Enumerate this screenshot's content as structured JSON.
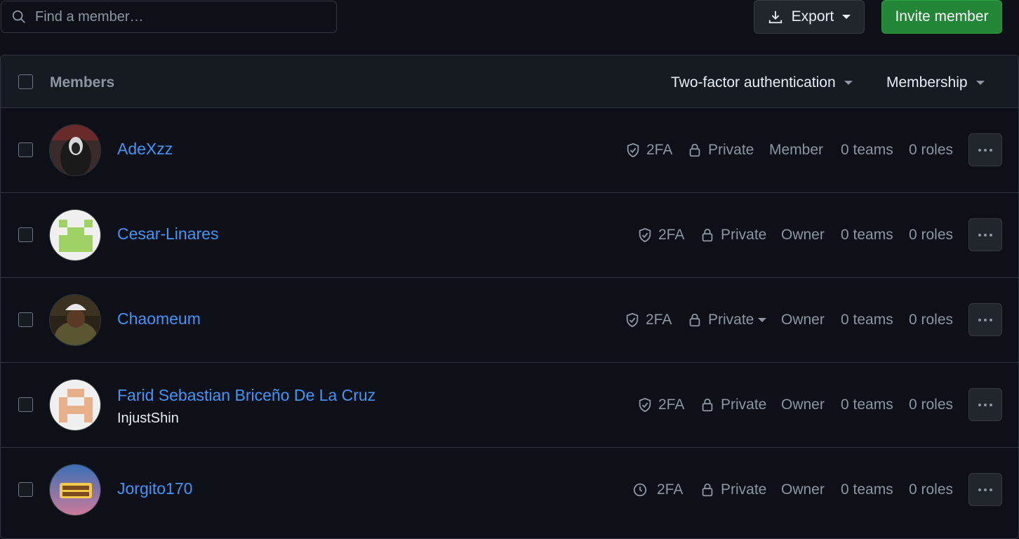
{
  "search": {
    "placeholder": "Find a member…"
  },
  "actions": {
    "export_label": "Export",
    "invite_label": "Invite member"
  },
  "table": {
    "header": {
      "title": "Members",
      "filter_2fa": "Two-factor authentication",
      "filter_membership": "Membership"
    },
    "rows": [
      {
        "name": "AdeXzz",
        "login": "",
        "twofa": "2FA",
        "twofa_icon": "shield-check-icon",
        "visibility": "Private",
        "visibility_dropdown": false,
        "role": "Member",
        "teams": "0 teams",
        "roles": "0 roles"
      },
      {
        "name": "Cesar-Linares",
        "login": "",
        "twofa": "2FA",
        "twofa_icon": "shield-check-icon",
        "visibility": "Private",
        "visibility_dropdown": false,
        "role": "Owner",
        "teams": "0 teams",
        "roles": "0 roles"
      },
      {
        "name": "Chaomeum",
        "login": "",
        "twofa": "2FA",
        "twofa_icon": "shield-check-icon",
        "visibility": "Private",
        "visibility_dropdown": true,
        "role": "Owner",
        "teams": "0 teams",
        "roles": "0 roles"
      },
      {
        "name": "Farid Sebastian Briceño De La Cruz",
        "login": "InjustShin",
        "twofa": "2FA",
        "twofa_icon": "shield-check-icon",
        "visibility": "Private",
        "visibility_dropdown": false,
        "role": "Owner",
        "teams": "0 teams",
        "roles": "0 roles"
      },
      {
        "name": "Jorgito170",
        "login": "",
        "twofa": "2FA",
        "twofa_icon": "clock-icon",
        "visibility": "Private",
        "visibility_dropdown": false,
        "role": "Owner",
        "teams": "0 teams",
        "roles": "0 roles"
      }
    ]
  },
  "colors": {
    "link": "#4493f8",
    "muted": "#8d96a0",
    "primary_button": "#238636",
    "background": "#0d1117"
  }
}
